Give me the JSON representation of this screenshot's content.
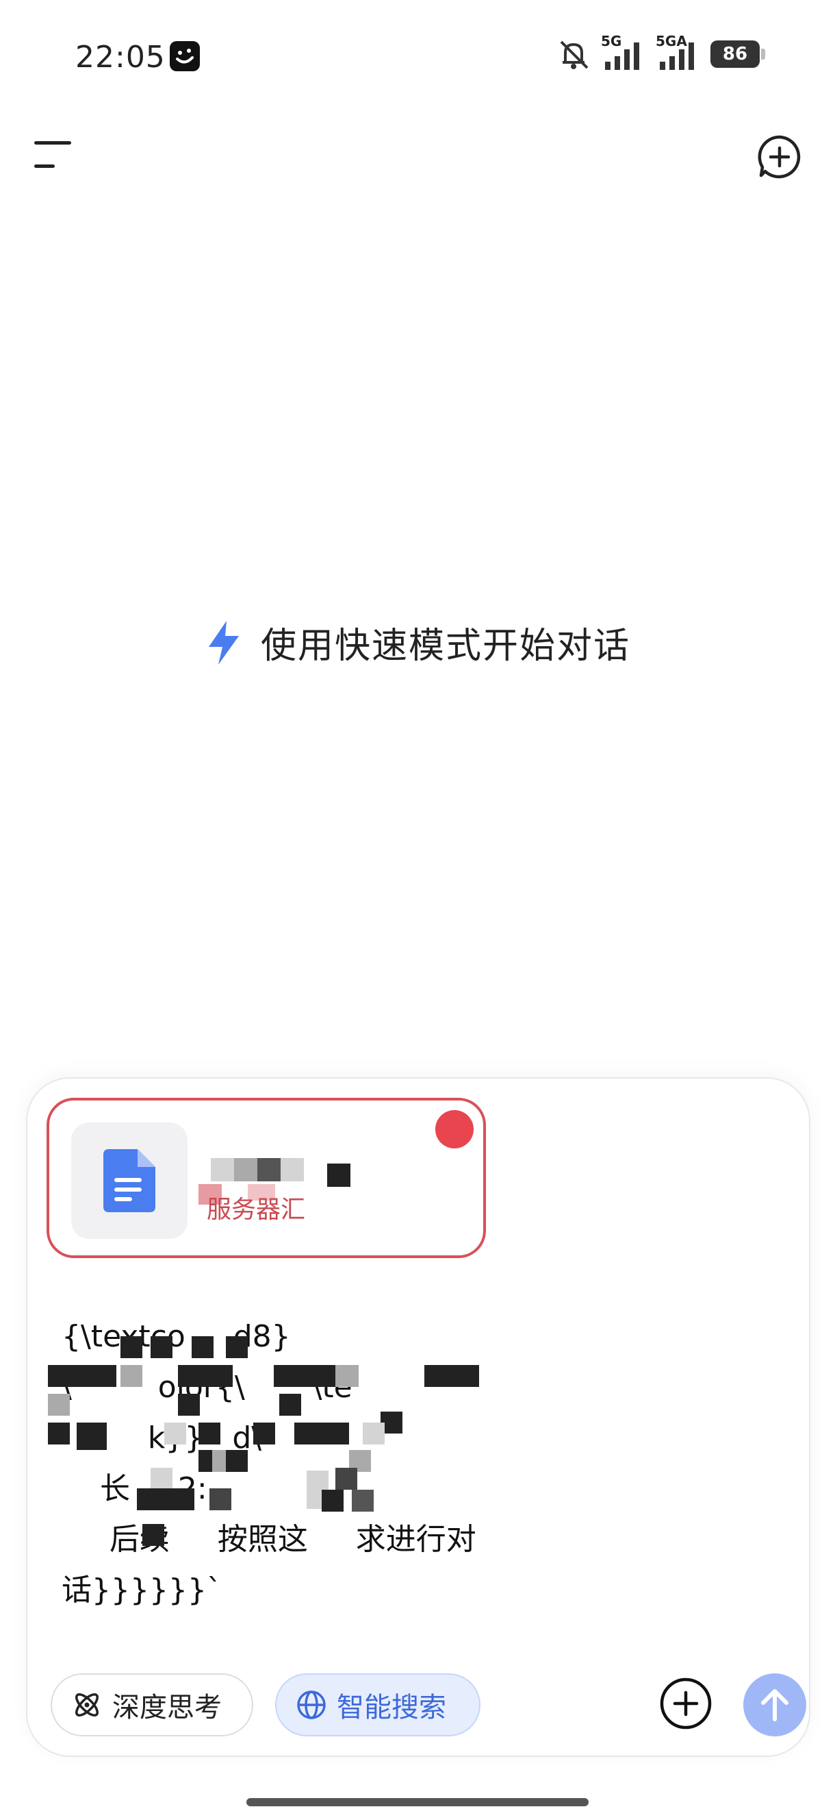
{
  "status_bar": {
    "time": "22:05",
    "network_1": "5G",
    "network_2": "5GA",
    "battery": "86"
  },
  "center": {
    "hint": "使用快速模式开始对话"
  },
  "composer": {
    "attachment": {
      "file_name": "服务器汇"
    },
    "message": "{\\textco     d8}\n\\         olor{\\       \\te\n         k}}   d\\\n    长     2:\n     后续     按照这     求进行对\n话}}}}}}`",
    "chips": {
      "deep_think": "深度思考",
      "smart_search": "智能搜索"
    }
  },
  "colors": {
    "accent": "#3d69d9",
    "send_disabled": "#9fb7f6",
    "attachment_border": "#d9505a"
  }
}
